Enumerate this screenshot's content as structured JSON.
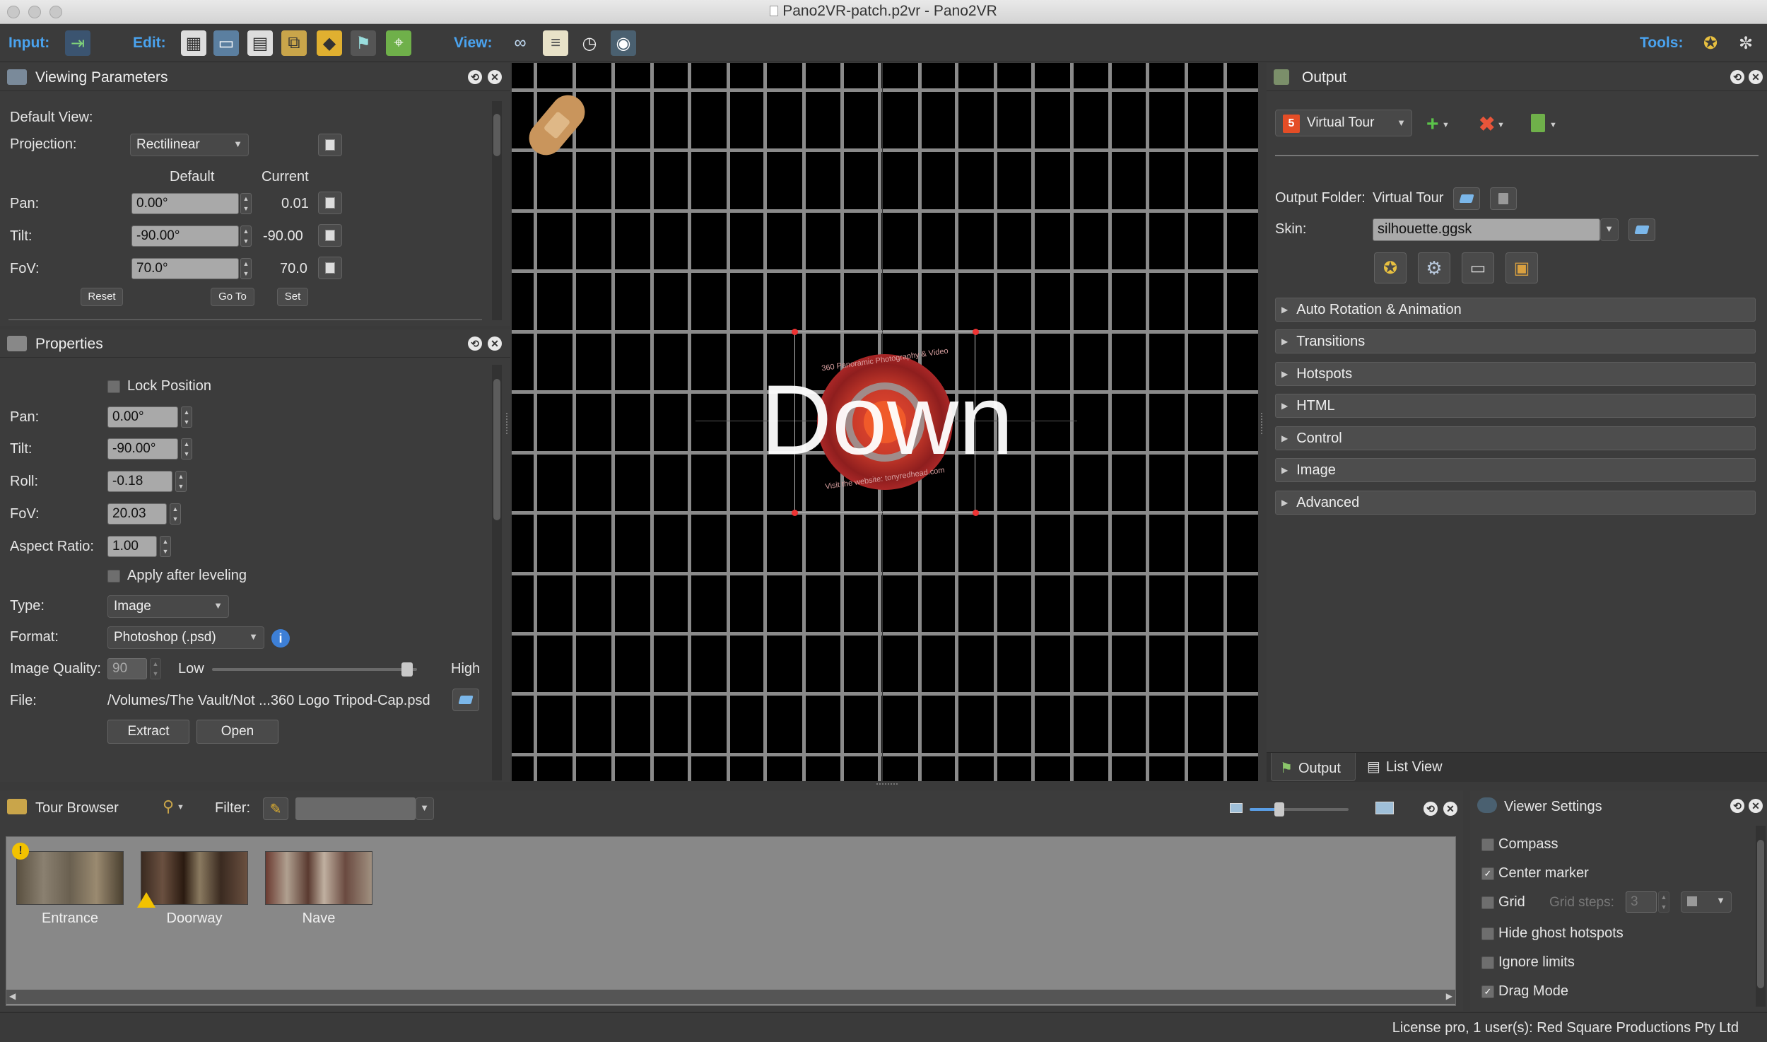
{
  "window": {
    "title": "Pano2VR-patch.p2vr - Pano2VR"
  },
  "toolbar": {
    "input_label": "Input:",
    "edit_label": "Edit:",
    "view_label": "View:",
    "tools_label": "Tools:"
  },
  "viewing_params": {
    "title": "Viewing Parameters",
    "default_view_label": "Default View:",
    "projection_label": "Projection:",
    "projection_value": "Rectilinear",
    "col_default": "Default",
    "col_current": "Current",
    "pan_label": "Pan:",
    "pan_default": "0.00°",
    "pan_current": "0.01",
    "tilt_label": "Tilt:",
    "tilt_default": "-90.00°",
    "tilt_current": "-90.00",
    "fov_label": "FoV:",
    "fov_default": "70.0°",
    "fov_current": "70.0",
    "reset": "Reset",
    "goto": "Go To",
    "set": "Set"
  },
  "properties": {
    "title": "Properties",
    "lock_position": "Lock Position",
    "pan_label": "Pan:",
    "pan_value": "0.00°",
    "tilt_label": "Tilt:",
    "tilt_value": "-90.00°",
    "roll_label": "Roll:",
    "roll_value": "-0.18",
    "fov_label": "FoV:",
    "fov_value": "20.03",
    "aspect_label": "Aspect Ratio:",
    "aspect_value": "1.00",
    "apply_after_leveling": "Apply after leveling",
    "type_label": "Type:",
    "type_value": "Image",
    "format_label": "Format:",
    "format_value": "Photoshop (.psd)",
    "quality_label": "Image Quality:",
    "quality_value": "90",
    "quality_low": "Low",
    "quality_high": "High",
    "quality_fraction": 0.95,
    "file_label": "File:",
    "file_value": "/Volumes/The Vault/Not ...360 Logo Tripod-Cap.psd",
    "extract": "Extract",
    "open": "Open"
  },
  "viewer": {
    "overlay_text": "Down",
    "patch_ring_text_top": "360 Panoramic Photography & Video",
    "patch_ring_text_bottom": "Visit the website: tonyredhead.com"
  },
  "output": {
    "title": "Output",
    "format": "Virtual Tour",
    "output_folder_label": "Output Folder:",
    "output_folder_value": "Virtual Tour",
    "skin_label": "Skin:",
    "skin_value": "silhouette.ggsk",
    "sections": [
      "Auto Rotation & Animation",
      "Transitions",
      "Hotspots",
      "HTML",
      "Control",
      "Image",
      "Advanced"
    ],
    "tab_output": "Output",
    "tab_listview": "List View"
  },
  "tour_browser": {
    "title": "Tour Browser",
    "filter_label": "Filter:",
    "zoom_fraction": 0.3,
    "panos": [
      {
        "label": "Entrance"
      },
      {
        "label": "Doorway"
      },
      {
        "label": "Nave"
      }
    ]
  },
  "viewer_settings": {
    "title": "Viewer Settings",
    "compass": "Compass",
    "center_marker": "Center marker",
    "grid": "Grid",
    "grid_steps_label": "Grid steps:",
    "grid_steps_value": "3",
    "hide_ghost": "Hide ghost hotspots",
    "ignore_limits": "Ignore limits",
    "drag_mode": "Drag Mode"
  },
  "status": {
    "license": "License pro, 1 user(s): Red Square Productions Pty Ltd"
  }
}
